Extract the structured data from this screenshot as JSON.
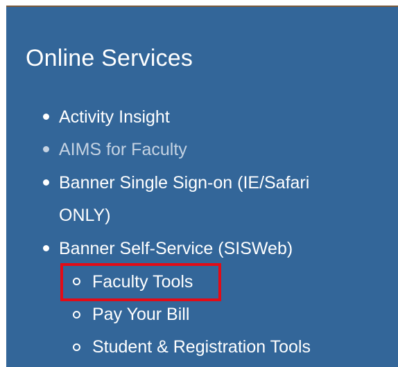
{
  "section": {
    "title": "Online Services",
    "items": [
      {
        "label": "Activity Insight",
        "faded": false
      },
      {
        "label": "AIMS for Faculty",
        "faded": true
      },
      {
        "label_line1": "Banner Single Sign-on (IE/Safari",
        "label_line2": "ONLY)",
        "faded": false
      },
      {
        "label": "Banner Self-Service (SISWeb)",
        "faded": false
      }
    ],
    "subitems": [
      {
        "label": "Faculty Tools",
        "highlighted": true
      },
      {
        "label": "Pay Your Bill",
        "highlighted": false
      },
      {
        "label": "Student & Registration Tools",
        "highlighted": false
      }
    ]
  },
  "colors": {
    "panel_background": "#336699",
    "text": "#ffffff",
    "faded_text": "#c5d3e3",
    "highlight_border": "#e30b16"
  }
}
